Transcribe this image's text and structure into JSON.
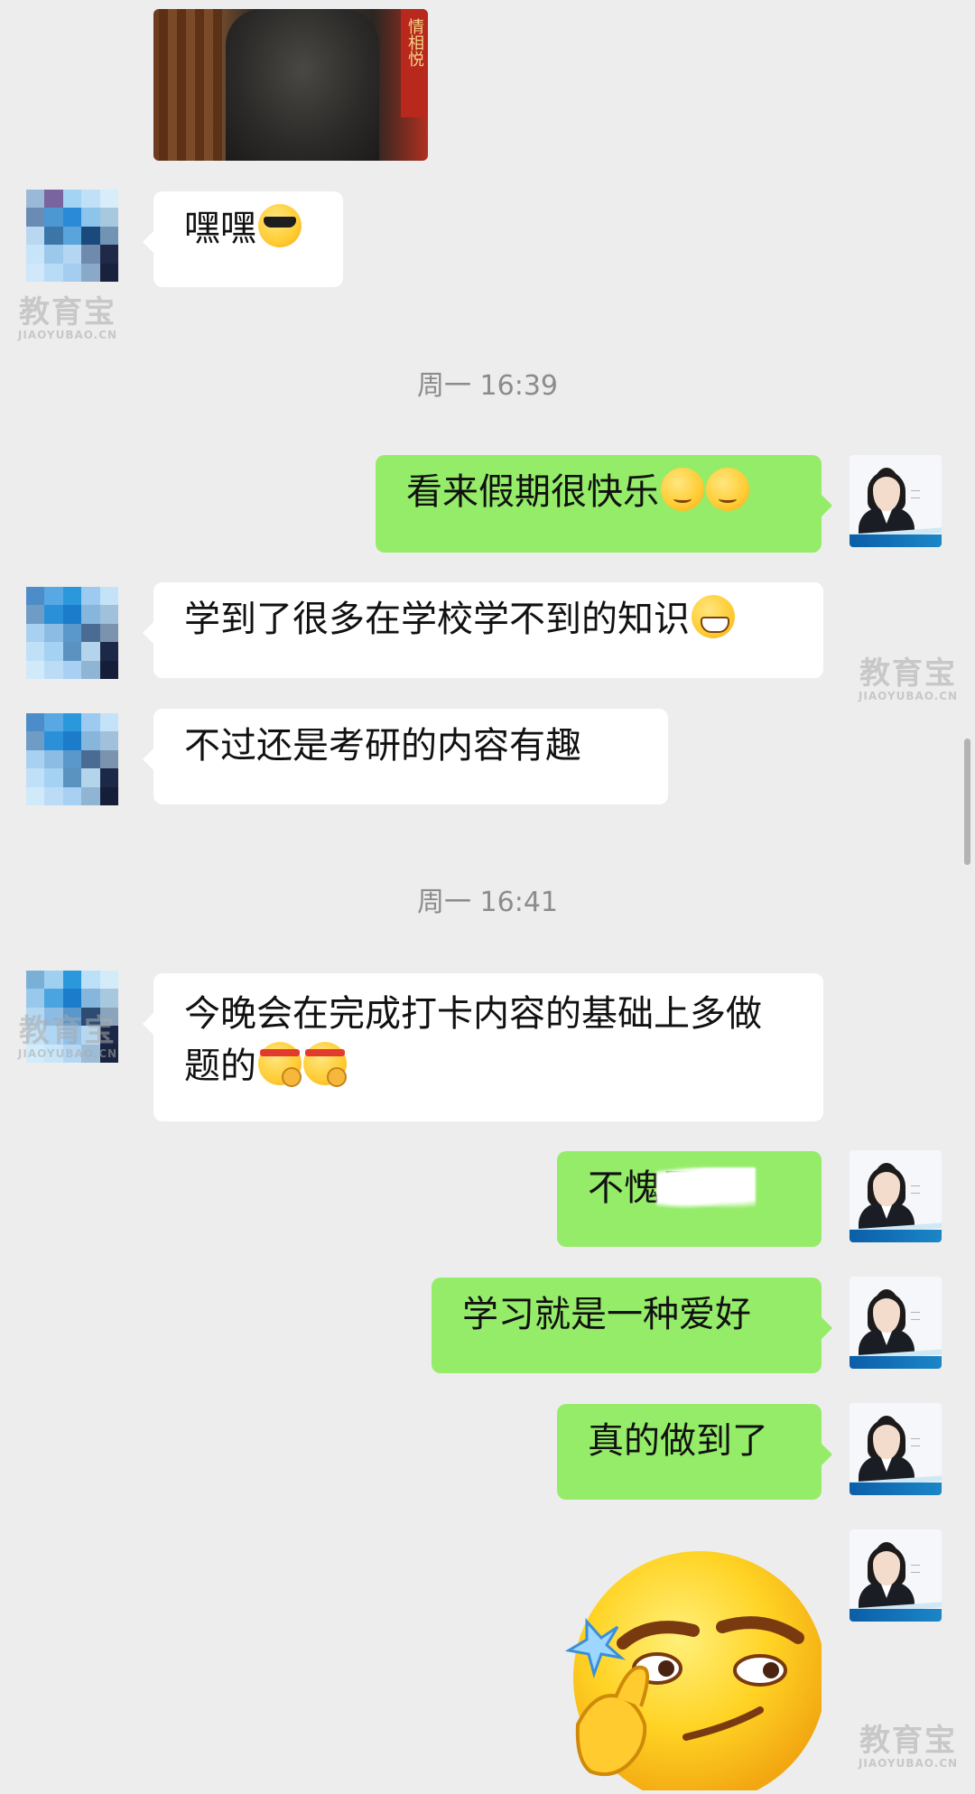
{
  "colors": {
    "background": "#ededed",
    "bubble_left": "#ffffff",
    "bubble_right": "#95ec69",
    "timestamp": "#8c8c8c"
  },
  "photo": {
    "banner_text": "情相悦"
  },
  "timestamps": {
    "t1": "周一 16:39",
    "t2": "周一 16:41"
  },
  "messages": [
    {
      "side": "left",
      "text": "嘿嘿",
      "emoji": [
        "cool-emoji"
      ]
    },
    {
      "side": "right",
      "text": "看来假期很快乐",
      "emoji": [
        "thinking-emoji",
        "thinking-emoji"
      ]
    },
    {
      "side": "left",
      "text": "学到了很多在学校学不到的知识",
      "emoji": [
        "grimacing-emoji"
      ]
    },
    {
      "side": "left",
      "text": "不过还是考研的内容有趣",
      "emoji": []
    },
    {
      "side": "left",
      "text": "今晚会在完成打卡内容的基础上多做题的",
      "emoji": [
        "determined-emoji",
        "determined-emoji"
      ]
    },
    {
      "side": "right",
      "text": "不愧是",
      "emoji": [],
      "note": "partially obscured"
    },
    {
      "side": "right",
      "text": "学习就是一种爱好",
      "emoji": []
    },
    {
      "side": "right",
      "text": "真的做到了",
      "emoji": []
    },
    {
      "side": "right",
      "sticker": "thinking-face-sticker"
    }
  ],
  "watermark": {
    "main": "教育宝",
    "sub": "JIAOYUBAO.CN"
  },
  "id_photo_avatar": {
    "stripe_text": "2022考研辅导专业课"
  }
}
